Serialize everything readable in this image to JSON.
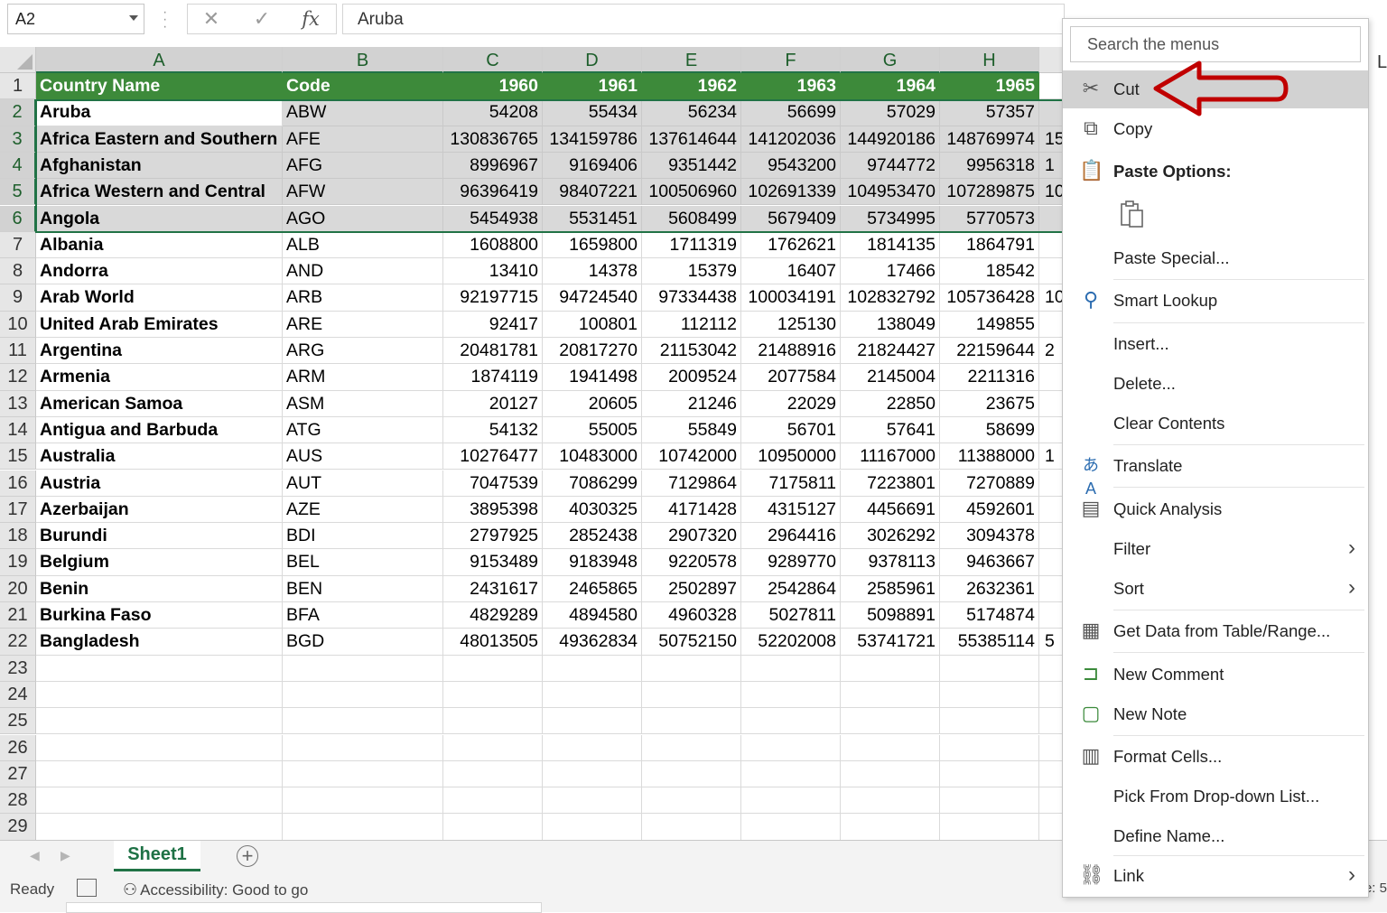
{
  "formula_bar": {
    "name_box": "A2",
    "cancel_icon": "✕",
    "enter_icon": "✓",
    "fx_label": "fx",
    "value": "Aruba"
  },
  "columns": [
    "A",
    "B",
    "C",
    "D",
    "E",
    "F",
    "G",
    "H"
  ],
  "extra_column_label": "L",
  "header_row": [
    "Country Name",
    "Code",
    "1960",
    "1961",
    "1962",
    "1963",
    "1964",
    "1965"
  ],
  "rows": [
    {
      "n": "2",
      "cells": [
        "Aruba",
        "ABW",
        "54208",
        "55434",
        "56234",
        "56699",
        "57029",
        "57357"
      ],
      "overflow": ""
    },
    {
      "n": "3",
      "cells": [
        "Africa Eastern and Southern",
        "AFE",
        "130836765",
        "134159786",
        "137614644",
        "141202036",
        "144920186",
        "148769974"
      ],
      "overflow": "15"
    },
    {
      "n": "4",
      "cells": [
        "Afghanistan",
        "AFG",
        "8996967",
        "9169406",
        "9351442",
        "9543200",
        "9744772",
        "9956318"
      ],
      "overflow": "1"
    },
    {
      "n": "5",
      "cells": [
        "Africa Western and Central",
        "AFW",
        "96396419",
        "98407221",
        "100506960",
        "102691339",
        "104953470",
        "107289875"
      ],
      "overflow": "10"
    },
    {
      "n": "6",
      "cells": [
        "Angola",
        "AGO",
        "5454938",
        "5531451",
        "5608499",
        "5679409",
        "5734995",
        "5770573"
      ],
      "overflow": ""
    },
    {
      "n": "7",
      "cells": [
        "Albania",
        "ALB",
        "1608800",
        "1659800",
        "1711319",
        "1762621",
        "1814135",
        "1864791"
      ],
      "overflow": ""
    },
    {
      "n": "8",
      "cells": [
        "Andorra",
        "AND",
        "13410",
        "14378",
        "15379",
        "16407",
        "17466",
        "18542"
      ],
      "overflow": ""
    },
    {
      "n": "9",
      "cells": [
        "Arab World",
        "ARB",
        "92197715",
        "94724540",
        "97334438",
        "100034191",
        "102832792",
        "105736428"
      ],
      "overflow": "10"
    },
    {
      "n": "10",
      "cells": [
        "United Arab Emirates",
        "ARE",
        "92417",
        "100801",
        "112112",
        "125130",
        "138049",
        "149855"
      ],
      "overflow": ""
    },
    {
      "n": "11",
      "cells": [
        "Argentina",
        "ARG",
        "20481781",
        "20817270",
        "21153042",
        "21488916",
        "21824427",
        "22159644"
      ],
      "overflow": "2"
    },
    {
      "n": "12",
      "cells": [
        "Armenia",
        "ARM",
        "1874119",
        "1941498",
        "2009524",
        "2077584",
        "2145004",
        "2211316"
      ],
      "overflow": ""
    },
    {
      "n": "13",
      "cells": [
        "American Samoa",
        "ASM",
        "20127",
        "20605",
        "21246",
        "22029",
        "22850",
        "23675"
      ],
      "overflow": ""
    },
    {
      "n": "14",
      "cells": [
        "Antigua and Barbuda",
        "ATG",
        "54132",
        "55005",
        "55849",
        "56701",
        "57641",
        "58699"
      ],
      "overflow": ""
    },
    {
      "n": "15",
      "cells": [
        "Australia",
        "AUS",
        "10276477",
        "10483000",
        "10742000",
        "10950000",
        "11167000",
        "11388000"
      ],
      "overflow": "1"
    },
    {
      "n": "16",
      "cells": [
        "Austria",
        "AUT",
        "7047539",
        "7086299",
        "7129864",
        "7175811",
        "7223801",
        "7270889"
      ],
      "overflow": ""
    },
    {
      "n": "17",
      "cells": [
        "Azerbaijan",
        "AZE",
        "3895398",
        "4030325",
        "4171428",
        "4315127",
        "4456691",
        "4592601"
      ],
      "overflow": ""
    },
    {
      "n": "18",
      "cells": [
        "Burundi",
        "BDI",
        "2797925",
        "2852438",
        "2907320",
        "2964416",
        "3026292",
        "3094378"
      ],
      "overflow": ""
    },
    {
      "n": "19",
      "cells": [
        "Belgium",
        "BEL",
        "9153489",
        "9183948",
        "9220578",
        "9289770",
        "9378113",
        "9463667"
      ],
      "overflow": ""
    },
    {
      "n": "20",
      "cells": [
        "Benin",
        "BEN",
        "2431617",
        "2465865",
        "2502897",
        "2542864",
        "2585961",
        "2632361"
      ],
      "overflow": ""
    },
    {
      "n": "21",
      "cells": [
        "Burkina Faso",
        "BFA",
        "4829289",
        "4894580",
        "4960328",
        "5027811",
        "5098891",
        "5174874"
      ],
      "overflow": ""
    },
    {
      "n": "22",
      "cells": [
        "Bangladesh",
        "BGD",
        "48013505",
        "49362834",
        "50752150",
        "52202008",
        "53741721",
        "55385114"
      ],
      "overflow": "5"
    },
    {
      "n": "23",
      "cells": [
        "",
        "",
        "",
        "",
        "",
        "",
        "",
        ""
      ],
      "overflow": ""
    },
    {
      "n": "24",
      "cells": [
        "",
        "",
        "",
        "",
        "",
        "",
        "",
        ""
      ],
      "overflow": ""
    },
    {
      "n": "25",
      "cells": [
        "",
        "",
        "",
        "",
        "",
        "",
        "",
        ""
      ],
      "overflow": ""
    },
    {
      "n": "26",
      "cells": [
        "",
        "",
        "",
        "",
        "",
        "",
        "",
        ""
      ],
      "overflow": ""
    },
    {
      "n": "27",
      "cells": [
        "",
        "",
        "",
        "",
        "",
        "",
        "",
        ""
      ],
      "overflow": ""
    },
    {
      "n": "28",
      "cells": [
        "",
        "",
        "",
        "",
        "",
        "",
        "",
        ""
      ],
      "overflow": ""
    },
    {
      "n": "29",
      "cells": [
        "",
        "",
        "",
        "",
        "",
        "",
        "",
        ""
      ],
      "overflow": ""
    }
  ],
  "sheet_tabs": {
    "active": "Sheet1",
    "add_icon": "+"
  },
  "status_bar": {
    "ready": "Ready",
    "accessibility": "Accessibility: Good to go",
    "right_text": "e: 5"
  },
  "context_menu": {
    "search_placeholder": "Search the menus",
    "items": {
      "cut": "Cut",
      "copy": "Copy",
      "paste_options": "Paste Options:",
      "paste_special": "Paste Special...",
      "smart_lookup": "Smart Lookup",
      "insert": "Insert...",
      "delete": "Delete...",
      "clear_contents": "Clear Contents",
      "translate": "Translate",
      "quick_analysis": "Quick Analysis",
      "filter": "Filter",
      "sort": "Sort",
      "get_data": "Get Data from Table/Range...",
      "new_comment": "New Comment",
      "new_note": "New Note",
      "format_cells": "Format Cells...",
      "pick_dropdown": "Pick From Drop-down List...",
      "define_name": "Define Name...",
      "link": "Link"
    },
    "submenu_glyph": "›"
  },
  "colors": {
    "excel_green": "#217346",
    "header_fill": "#3d8a3a",
    "selection_fill": "#d9d9d9",
    "arrow_red": "#c00000"
  }
}
